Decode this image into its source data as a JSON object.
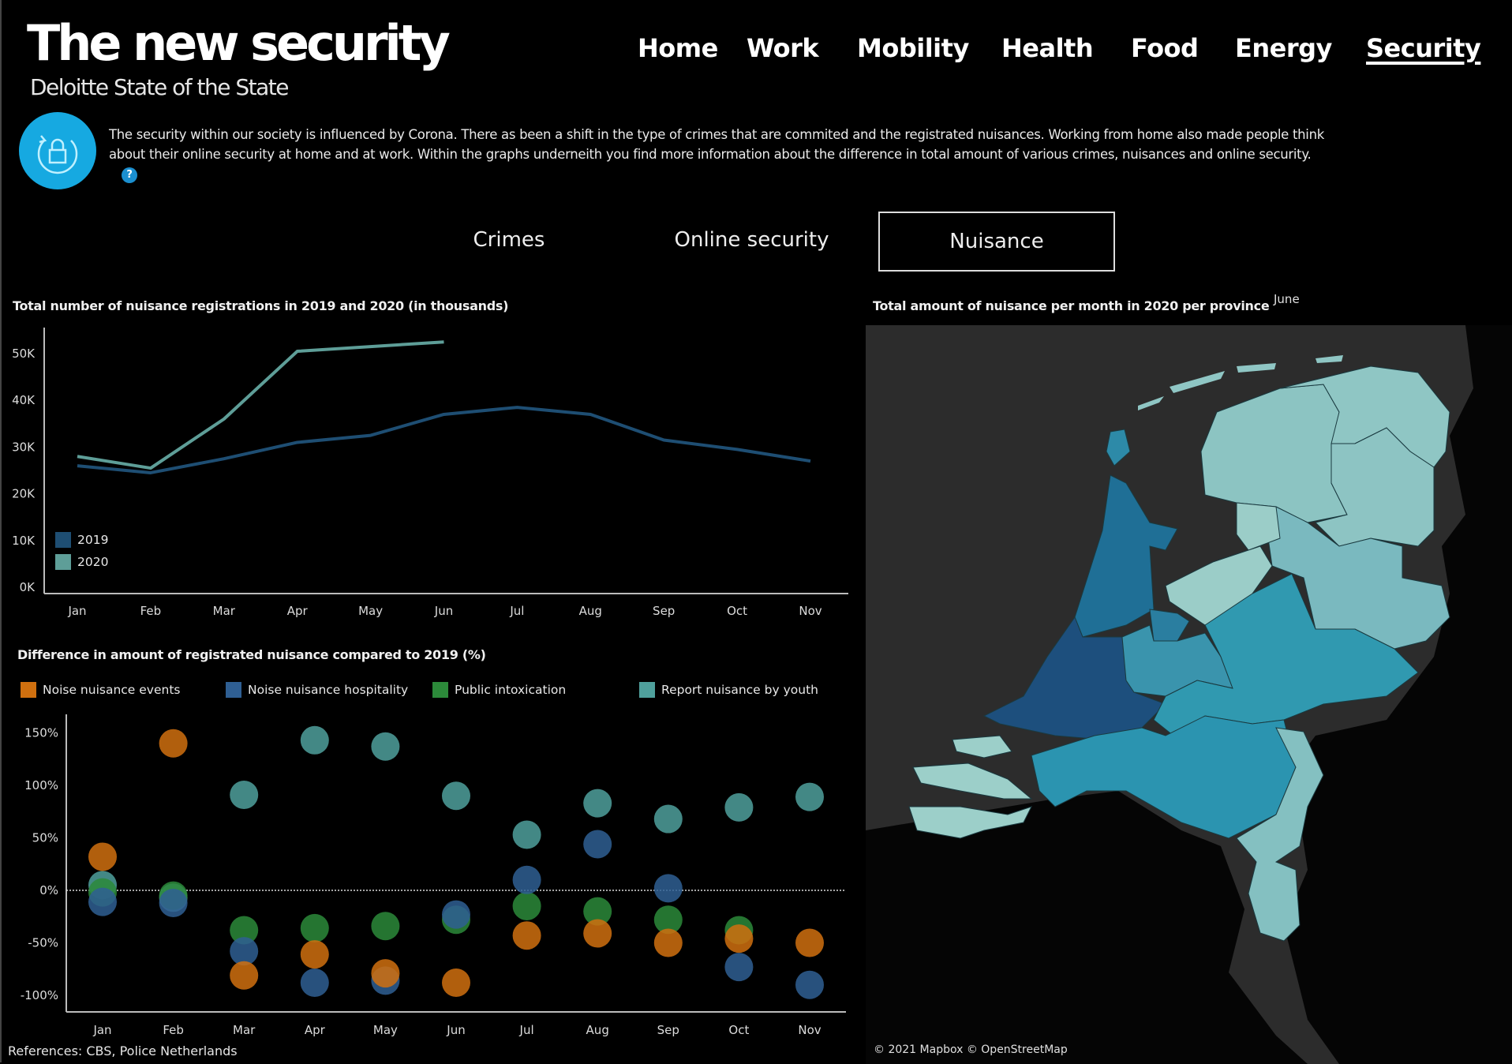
{
  "header": {
    "title": "The new security",
    "subtitle": "Deloitte State of the State"
  },
  "nav": {
    "items": [
      {
        "label": "Home",
        "active": false
      },
      {
        "label": "Work",
        "active": false
      },
      {
        "label": "Mobility",
        "active": false
      },
      {
        "label": "Health",
        "active": false
      },
      {
        "label": "Food",
        "active": false
      },
      {
        "label": "Energy",
        "active": false
      },
      {
        "label": "Security",
        "active": true
      }
    ]
  },
  "intro": {
    "icon": "lock-refresh-icon",
    "icon_color": "#16a9e1",
    "text": "The security within our society is influenced by Corona. There as been a shift in the type of crimes that are commited and the registrated nuisances. Working from home also made people think about their online security at home and at work.  Within the graphs underneith you find more information about the difference in total amount of various crimes, nuisances and online security.",
    "help_label": "?"
  },
  "tabs": [
    {
      "label": "Crimes",
      "active": false
    },
    {
      "label": "Online security",
      "active": false
    },
    {
      "label": "Nuisance",
      "active": true
    }
  ],
  "map": {
    "title": "Total amount of nuisance per month in 2020 per province",
    "month_filter": "June",
    "attribution": "© 2021 Mapbox © OpenStreetMap",
    "provinces": [
      {
        "name": "Groningen",
        "color": "#8cc4c2"
      },
      {
        "name": "Friesland",
        "color": "#8fc6c4"
      },
      {
        "name": "Drenthe",
        "color": "#8dc4c3"
      },
      {
        "name": "Overijssel",
        "color": "#7ab9bf"
      },
      {
        "name": "Flevoland",
        "color": "#9bcdc8"
      },
      {
        "name": "Noord-Holland",
        "color": "#1f6f96"
      },
      {
        "name": "Zuid-Holland",
        "color": "#1d4f7d"
      },
      {
        "name": "Utrecht",
        "color": "#3a94ad"
      },
      {
        "name": "Gelderland",
        "color": "#3099b0"
      },
      {
        "name": "Zeeland",
        "color": "#9ccfc9"
      },
      {
        "name": "Noord-Brabant",
        "color": "#2b94b0"
      },
      {
        "name": "Limburg",
        "color": "#84c0c1"
      },
      {
        "name": "Texel",
        "color": "#2d8aa8"
      },
      {
        "name": "Amsterdam-Almere",
        "color": "#2a7ea0"
      }
    ]
  },
  "references": "References: CBS, Police Netherlands",
  "chart_data": [
    {
      "type": "line",
      "title": "Total number of nuisance registrations in 2019 and 2020 (in thousands)",
      "categories": [
        "Jan",
        "Feb",
        "Mar",
        "Apr",
        "May",
        "Jun",
        "Jul",
        "Aug",
        "Sep",
        "Oct",
        "Nov"
      ],
      "xlabel": "",
      "ylabel": "",
      "ylim": [
        0,
        55
      ],
      "yticks": [
        "0K",
        "10K",
        "20K",
        "30K",
        "40K",
        "50K"
      ],
      "ytick_values": [
        0,
        10,
        20,
        30,
        40,
        50
      ],
      "legend_position": "bottom-left",
      "grid": false,
      "series": [
        {
          "name": "2019",
          "color": "#1e4e73",
          "values": [
            26,
            24.5,
            27.5,
            31,
            32.5,
            37,
            38.5,
            37,
            31.5,
            29.5,
            27
          ]
        },
        {
          "name": "2020",
          "color": "#5e9e98",
          "values": [
            28,
            25.5,
            36,
            50.5,
            51.5,
            52.5,
            null,
            null,
            null,
            null,
            null
          ]
        }
      ]
    },
    {
      "type": "scatter",
      "title": "Difference in amount of registrated nuisance compared to 2019 (%)",
      "categories": [
        "Jan",
        "Feb",
        "Mar",
        "Apr",
        "May",
        "Jun",
        "Jul",
        "Aug",
        "Sep",
        "Oct",
        "Nov"
      ],
      "xlabel": "",
      "ylabel": "",
      "ylim": [
        -110,
        165
      ],
      "yticks": [
        "150%",
        "100%",
        "50%",
        "0%",
        "-50%",
        "-100%"
      ],
      "ytick_values": [
        150,
        100,
        50,
        0,
        -50,
        -100
      ],
      "reference_line": 0,
      "legend_position": "top",
      "grid": false,
      "series": [
        {
          "name": "Noise nuisance events",
          "color": "#d0700f",
          "values": [
            32,
            140,
            -81,
            -61,
            -79,
            -88,
            -43,
            -41,
            -50,
            -46,
            -50
          ]
        },
        {
          "name": "Noise nuisance hospitality",
          "color": "#2f5f93",
          "values": [
            -11,
            -12,
            -58,
            -88,
            -86,
            -23,
            10,
            44,
            2,
            -73,
            -90
          ]
        },
        {
          "name": "Public intoxication",
          "color": "#2c8a3a",
          "values": [
            -2,
            -5,
            -38,
            -36,
            -34,
            -28,
            -15,
            -20,
            -28,
            -38,
            null
          ]
        },
        {
          "name": "Report nuisance by youth",
          "color": "#4fa09c",
          "values": [
            5,
            -7,
            91,
            143,
            137,
            90,
            53,
            83,
            68,
            79,
            89
          ]
        }
      ]
    }
  ]
}
